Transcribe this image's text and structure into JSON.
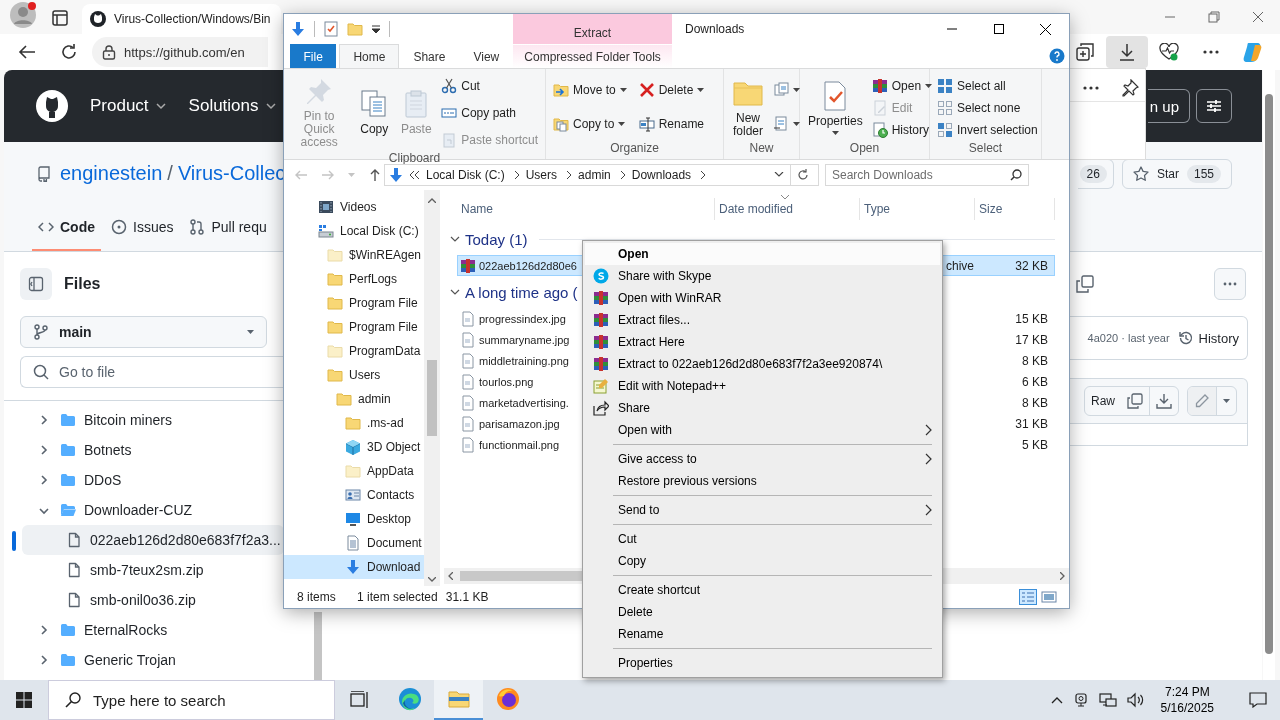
{
  "browser": {
    "tab_title": "Virus-Collection/Windows/Bin",
    "url": "https://github.com/en",
    "downloads_active": true
  },
  "github": {
    "nav": [
      "Product",
      "Solutions"
    ],
    "signup": "n up",
    "owner": "enginestein",
    "separator": "/",
    "repo": "Virus-Collec",
    "fork_count": "26",
    "star_label": "Star",
    "star_count": "155",
    "tabs": [
      {
        "label": "Code",
        "selected": true
      },
      {
        "label": "Issues",
        "selected": false
      },
      {
        "label": "Pull requ",
        "selected": false
      }
    ],
    "files_title": "Files",
    "branch": "main",
    "search_placeholder": "Go to file",
    "tree": [
      {
        "label": "Bitcoin miners",
        "kind": "folder",
        "expanded": false,
        "selected": false
      },
      {
        "label": "Botnets",
        "kind": "folder",
        "expanded": false,
        "selected": false
      },
      {
        "label": "DDoS",
        "kind": "folder",
        "expanded": false,
        "selected": false
      },
      {
        "label": "Downloader-CUZ",
        "kind": "folder",
        "expanded": true,
        "selected": false,
        "children": [
          {
            "label": "022aeb126d2d80e683f7f2a3...",
            "kind": "file",
            "selected": true
          },
          {
            "label": "smb-7teux2sm.zip",
            "kind": "file",
            "selected": false
          },
          {
            "label": "smb-onil0o36.zip",
            "kind": "file",
            "selected": false
          }
        ]
      },
      {
        "label": "EternalRocks",
        "kind": "folder",
        "expanded": false,
        "selected": false
      },
      {
        "label": "Generic Trojan",
        "kind": "folder",
        "expanded": false,
        "selected": false
      }
    ],
    "commit_info": "4a020 · last year",
    "history": "History",
    "raw": "Raw"
  },
  "explorer": {
    "title": "Downloads",
    "context_tab": "Extract",
    "tabs": [
      {
        "label": "File",
        "kind": "file",
        "selected": false
      },
      {
        "label": "Home",
        "kind": "tab",
        "selected": true
      },
      {
        "label": "Share",
        "kind": "tab",
        "selected": false
      },
      {
        "label": "View",
        "kind": "tab",
        "selected": false
      },
      {
        "label": "Compressed Folder Tools",
        "kind": "context",
        "selected": false
      }
    ],
    "ribbon": [
      {
        "label": "Clipboard",
        "columns": [
          [
            {
              "label": "Pin to Quick access",
              "kind": "large",
              "disabled": true,
              "dropdown": false
            }
          ],
          [
            {
              "label": "Copy",
              "kind": "large",
              "disabled": false,
              "dropdown": false
            }
          ],
          [
            {
              "label": "Paste",
              "kind": "large",
              "disabled": true,
              "dropdown": false
            }
          ],
          [
            {
              "label": "Cut",
              "kind": "small",
              "disabled": false,
              "dropdown": false
            },
            {
              "label": "Copy path",
              "kind": "small",
              "disabled": false,
              "dropdown": false
            },
            {
              "label": "Paste shortcut",
              "kind": "small",
              "disabled": true,
              "dropdown": false
            }
          ]
        ]
      },
      {
        "label": "Organize",
        "columns": [
          [
            {
              "label": "Move to",
              "kind": "small",
              "disabled": false,
              "dropdown": true
            },
            {
              "label": "Copy to",
              "kind": "small",
              "disabled": false,
              "dropdown": true
            }
          ],
          [
            {
              "label": "Delete",
              "kind": "small",
              "disabled": false,
              "dropdown": true
            },
            {
              "label": "Rename",
              "kind": "small",
              "disabled": false,
              "dropdown": false
            }
          ]
        ]
      },
      {
        "label": "New",
        "columns": [
          [
            {
              "label": "New folder",
              "kind": "large",
              "disabled": false,
              "dropdown": false
            }
          ],
          [
            {
              "kind": "icon",
              "disabled": false,
              "dropdown": true
            },
            {
              "kind": "icon",
              "disabled": false,
              "dropdown": true
            }
          ]
        ]
      },
      {
        "label": "Open",
        "columns": [
          [
            {
              "label": "Properties",
              "kind": "large",
              "disabled": false,
              "dropdown": true
            }
          ],
          [
            {
              "label": "Open",
              "kind": "small",
              "disabled": false,
              "dropdown": true
            },
            {
              "label": "Edit",
              "kind": "small",
              "disabled": true,
              "dropdown": false
            },
            {
              "label": "History",
              "kind": "small",
              "disabled": false,
              "dropdown": false
            }
          ]
        ]
      },
      {
        "label": "Select",
        "columns": [
          [
            {
              "label": "Select all",
              "kind": "small",
              "disabled": false,
              "dropdown": false
            },
            {
              "label": "Select none",
              "kind": "small",
              "disabled": false,
              "dropdown": false
            },
            {
              "label": "Invert selection",
              "kind": "small",
              "disabled": false,
              "dropdown": false
            }
          ]
        ]
      }
    ],
    "path": [
      "Local Disk (C:)",
      "Users",
      "admin",
      "Downloads"
    ],
    "search_placeholder": "Search Downloads",
    "nav_pane": [
      {
        "label": "Videos",
        "selected": false
      },
      {
        "label": "Local Disk (C:)",
        "selected": false,
        "children": [
          {
            "label": "$WinREAgen",
            "selected": false
          },
          {
            "label": "PerfLogs",
            "selected": false
          },
          {
            "label": "Program File",
            "selected": false
          },
          {
            "label": "Program File",
            "selected": false
          },
          {
            "label": "ProgramData",
            "selected": false
          },
          {
            "label": "Users",
            "selected": false,
            "children": [
              {
                "label": "admin",
                "selected": false,
                "children": [
                  {
                    "label": ".ms-ad",
                    "selected": false
                  },
                  {
                    "label": "3D Object",
                    "selected": false
                  },
                  {
                    "label": "AppData",
                    "selected": false
                  },
                  {
                    "label": "Contacts",
                    "selected": false
                  },
                  {
                    "label": "Desktop",
                    "selected": false
                  },
                  {
                    "label": "Document",
                    "selected": false
                  },
                  {
                    "label": "Download",
                    "selected": true
                  }
                ]
              }
            ]
          }
        ]
      }
    ],
    "columns": [
      "Name",
      "Date modified",
      "Type",
      "Size"
    ],
    "groups": [
      {
        "label": "Today (1)",
        "expanded": true,
        "files": [
          {
            "name": "022aeb126d2d80e6",
            "kind": "archive",
            "type": "chive",
            "size": "32 KB",
            "selected": true
          }
        ]
      },
      {
        "label": "A long time ago (",
        "expanded": true,
        "files": [
          {
            "name": "progressindex.jpg",
            "kind": "image",
            "size": "15 KB",
            "selected": false
          },
          {
            "name": "summaryname.jpg",
            "kind": "image",
            "size": "17 KB",
            "selected": false
          },
          {
            "name": "middletraining.png",
            "kind": "image",
            "size": "8 KB",
            "selected": false
          },
          {
            "name": "tourlos.png",
            "kind": "image",
            "size": "6 KB",
            "selected": false
          },
          {
            "name": "marketadvertising.",
            "kind": "image",
            "size": "8 KB",
            "selected": false
          },
          {
            "name": "parisamazon.jpg",
            "kind": "image",
            "size": "31 KB",
            "selected": false
          },
          {
            "name": "functionmail.png",
            "kind": "image",
            "size": "5 KB",
            "selected": false
          }
        ]
      }
    ],
    "status": [
      "8 items",
      "1 item selected",
      "31.1 KB"
    ]
  },
  "context_menu": [
    {
      "label": "Open",
      "kind": "default",
      "selected": true
    },
    {
      "label": "Share with Skype",
      "kind": "item",
      "selected": false
    },
    {
      "label": "Open with WinRAR",
      "kind": "item",
      "selected": false
    },
    {
      "label": "Extract files...",
      "kind": "item",
      "selected": false
    },
    {
      "label": "Extract Here",
      "kind": "item",
      "selected": false
    },
    {
      "label": "Extract to 022aeb126d2d80e683f7f2a3ee920874\\",
      "kind": "item",
      "selected": false
    },
    {
      "label": "Edit with Notepad++",
      "kind": "item",
      "selected": false
    },
    {
      "label": "Share",
      "kind": "item",
      "selected": false
    },
    {
      "label": "Open with",
      "kind": "submenu",
      "selected": false
    },
    {
      "kind": "separator"
    },
    {
      "label": "Give access to",
      "kind": "submenu",
      "selected": false
    },
    {
      "label": "Restore previous versions",
      "kind": "item",
      "selected": false
    },
    {
      "kind": "separator"
    },
    {
      "label": "Send to",
      "kind": "submenu",
      "selected": false
    },
    {
      "kind": "separator"
    },
    {
      "label": "Cut",
      "kind": "item",
      "selected": false
    },
    {
      "label": "Copy",
      "kind": "item",
      "selected": false
    },
    {
      "kind": "separator"
    },
    {
      "label": "Create shortcut",
      "kind": "item",
      "selected": false
    },
    {
      "label": "Delete",
      "kind": "item",
      "selected": false
    },
    {
      "label": "Rename",
      "kind": "item",
      "selected": false
    },
    {
      "kind": "separator"
    },
    {
      "label": "Properties",
      "kind": "item",
      "selected": false
    }
  ],
  "taskbar": {
    "search_placeholder": "Type here to search",
    "apps": [
      {
        "selected": false
      },
      {
        "selected": true
      },
      {
        "selected": false
      }
    ],
    "time": "7:24 PM",
    "date": "5/16/2025"
  }
}
